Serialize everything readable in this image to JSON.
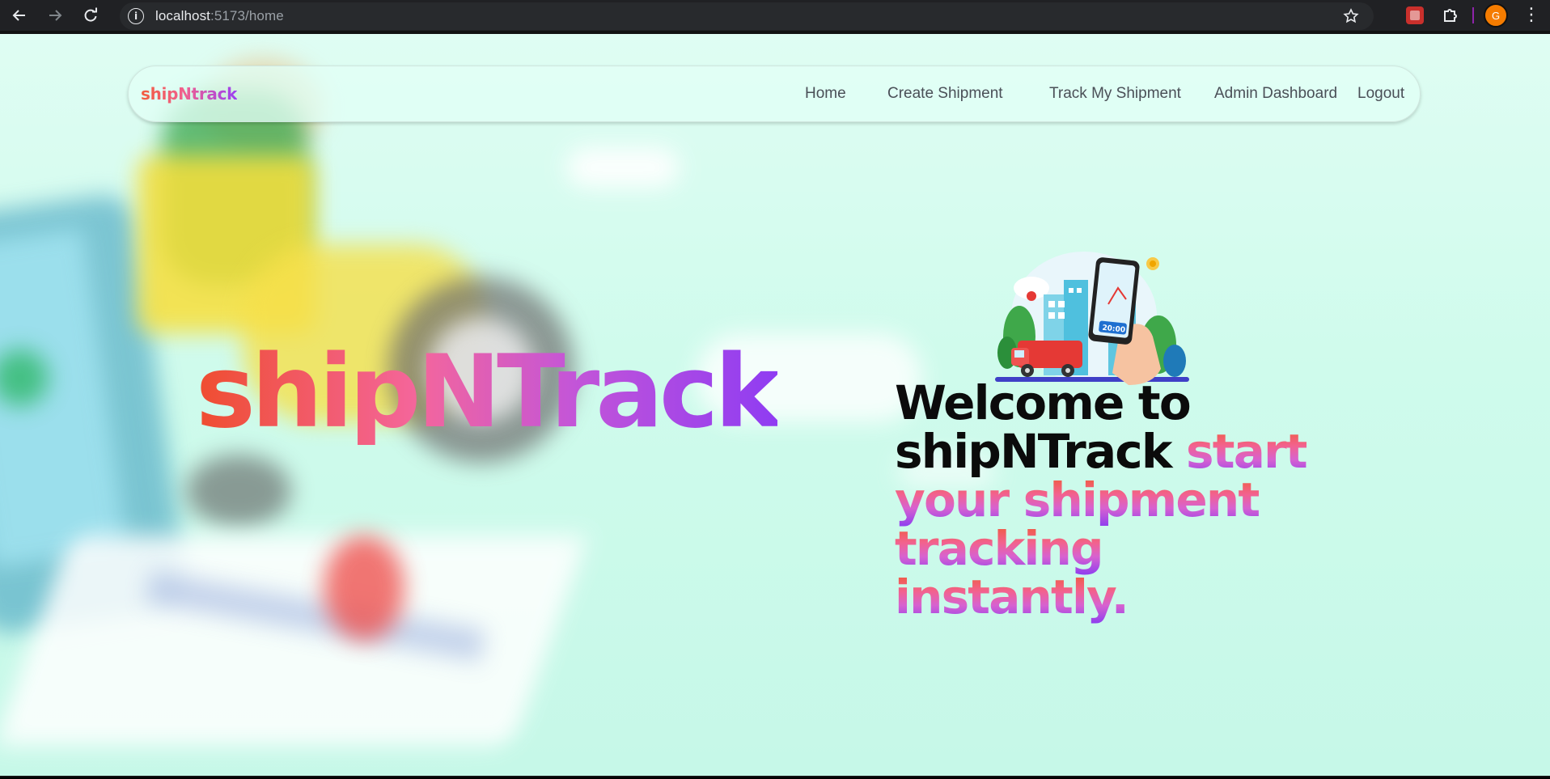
{
  "browser": {
    "url_host": "localhost",
    "url_path": ":5173/home",
    "avatar_letter": "G"
  },
  "navbar": {
    "brand": "shipNtrack",
    "links": [
      "Home",
      "Create Shipment",
      "Track My Shipment",
      "Admin Dashboard",
      "Logout"
    ]
  },
  "hero": {
    "title": "shipNTrack",
    "headline_dark": "Welcome to shipNTrack",
    "headline_gradient": "start your shipment tracking instantly.",
    "illustration_time": "20:00"
  },
  "colors": {
    "gradient_start": "#ef4d2f",
    "gradient_mid": "#f4669c",
    "gradient_end": "#8f3cf2",
    "background": "#d4fcef"
  }
}
